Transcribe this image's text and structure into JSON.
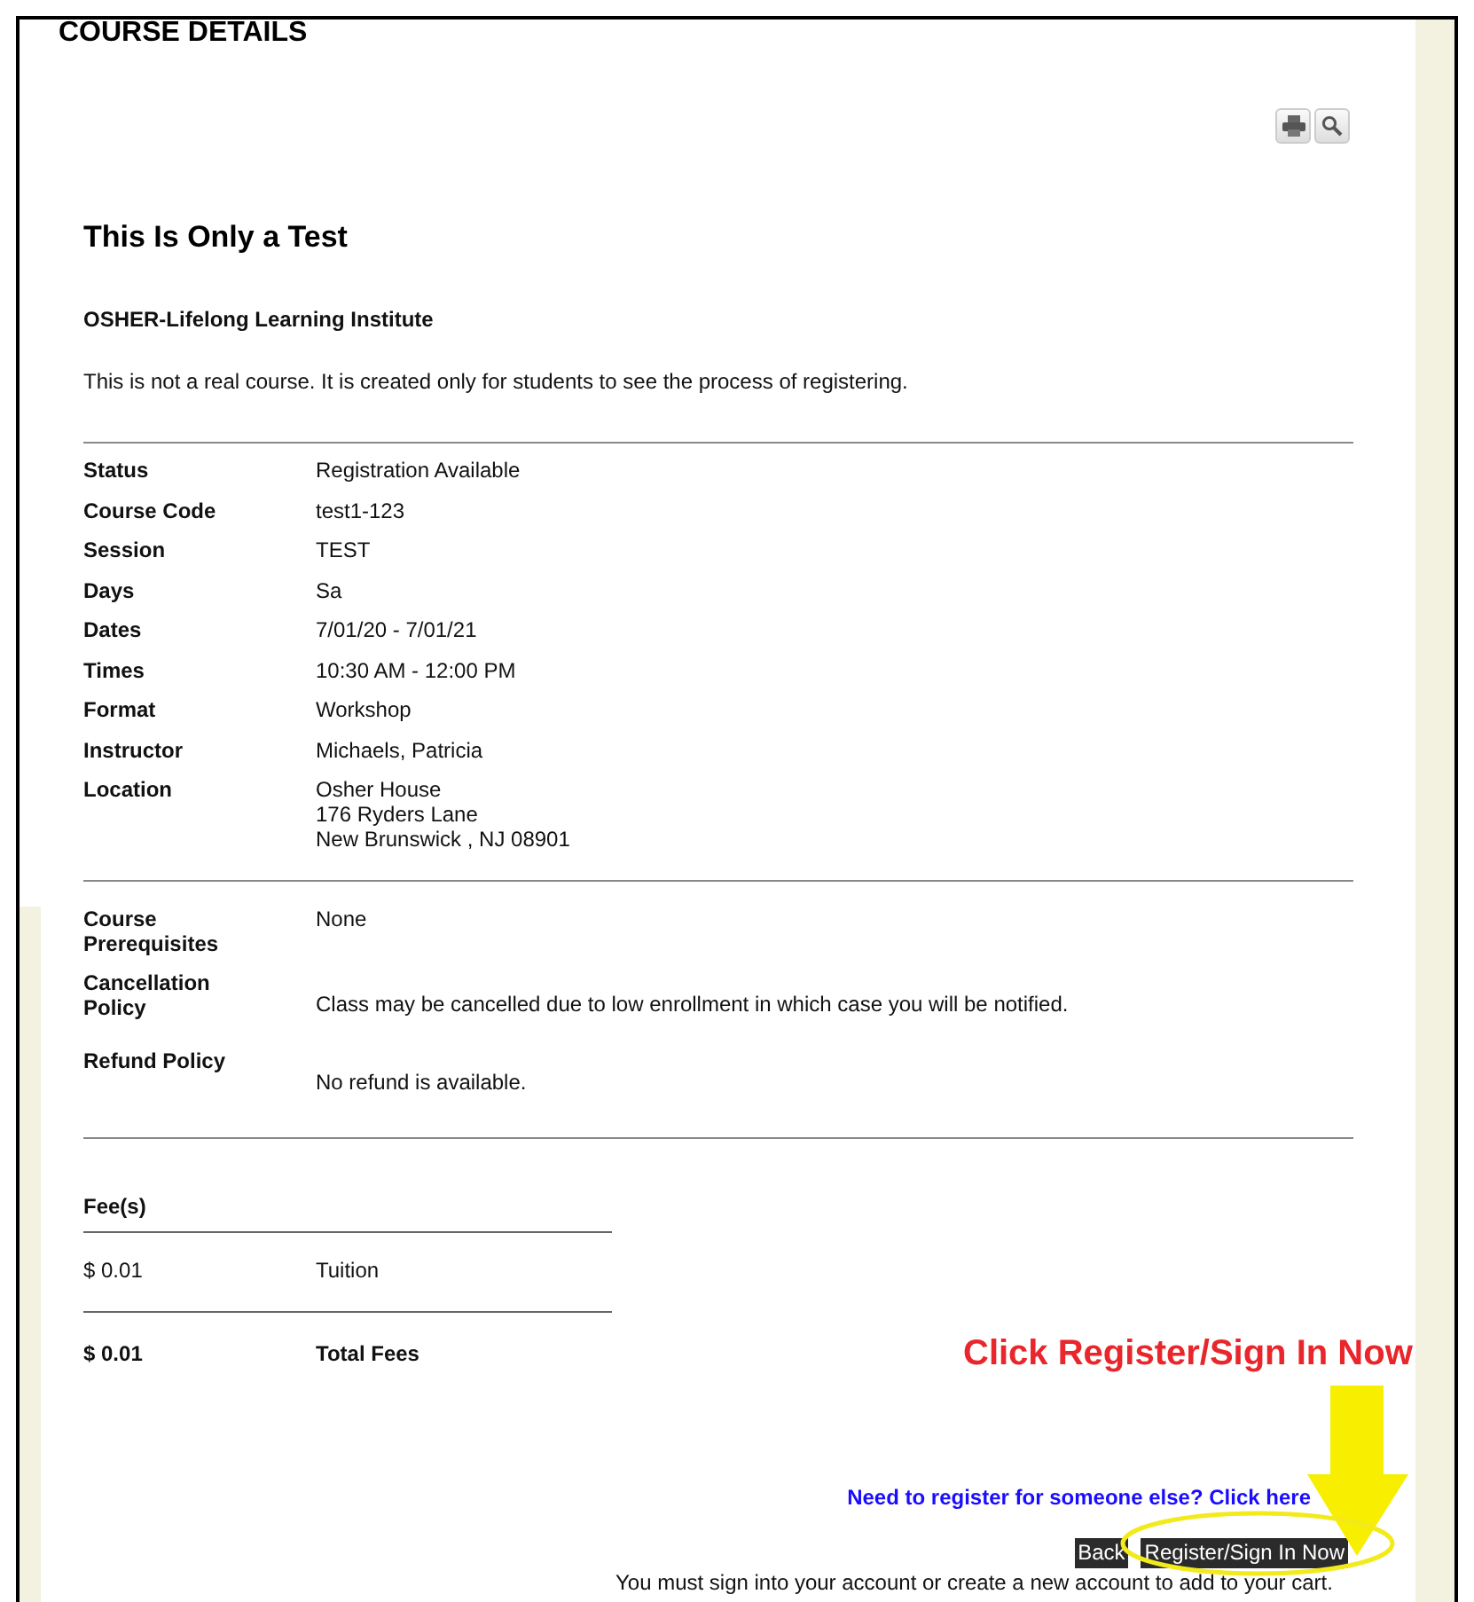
{
  "page_title": "COURSE DETAILS",
  "course": {
    "title": "This Is Only a Test",
    "provider": "OSHER-Lifelong Learning Institute",
    "description": "This is not a real course. It is created only for students to see the process of registering."
  },
  "details": [
    {
      "label": "Status",
      "lines": [
        "Registration Available"
      ]
    },
    {
      "label": "Course Code",
      "lines": [
        "test1-123"
      ]
    },
    {
      "label": "Session",
      "lines": [
        "TEST"
      ]
    },
    {
      "label": "Days",
      "lines": [
        "Sa"
      ]
    },
    {
      "label": "Dates",
      "lines": [
        "7/01/20 - 7/01/21"
      ]
    },
    {
      "label": "Times",
      "lines": [
        "10:30 AM - 12:00 PM"
      ]
    },
    {
      "label": "Format",
      "lines": [
        "Workshop"
      ]
    },
    {
      "label": "Instructor",
      "lines": [
        "Michaels, Patricia"
      ]
    },
    {
      "label": "Location",
      "lines": [
        "Osher House",
        "176 Ryders Lane",
        "New Brunswick , NJ 08901"
      ]
    }
  ],
  "policies": [
    {
      "kind": "inline",
      "label": "Course Prerequisites",
      "value": "None"
    },
    {
      "kind": "below",
      "label": "Cancellation Policy",
      "value": "Class may be cancelled due to low enrollment in which case you will be notified."
    },
    {
      "kind": "below",
      "label": "Refund Policy",
      "value": "No refund is available."
    }
  ],
  "fees": {
    "heading": "Fee(s)",
    "items": [
      {
        "amount": "$ 0.01",
        "label": "Tuition"
      }
    ],
    "total": {
      "amount": "$ 0.01",
      "label": "Total Fees"
    }
  },
  "link": "Need to register for someone else? Click here",
  "buttons": [
    "Back",
    "Register/Sign In Now"
  ],
  "note": "You must sign into your account or create a new account to add to your cart.",
  "annotation": {
    "text": "Click Register/Sign In Now"
  }
}
